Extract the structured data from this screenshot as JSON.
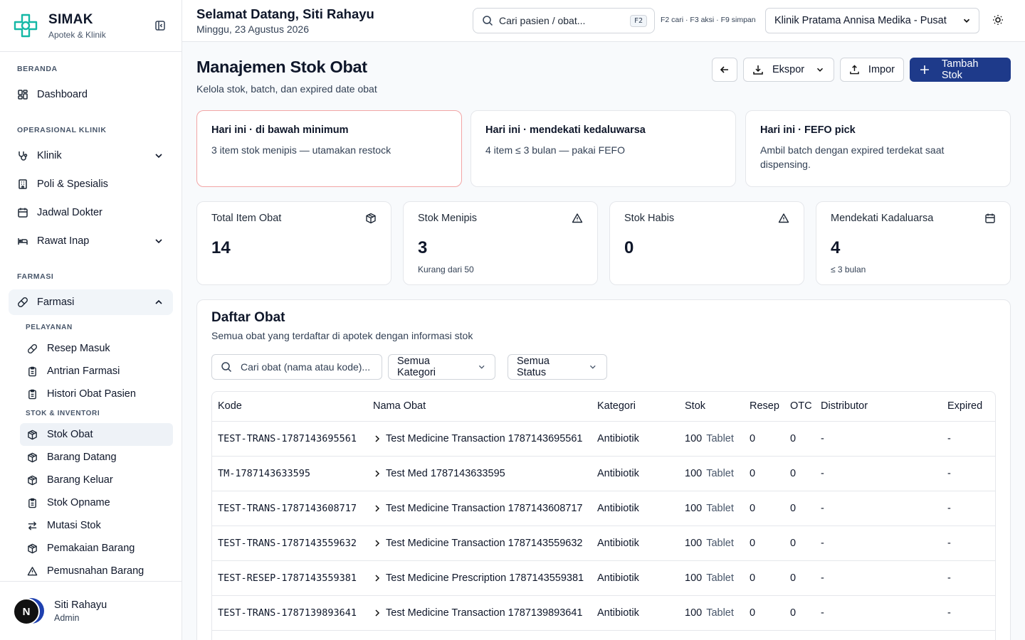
{
  "brand": {
    "name": "SIMAK",
    "subtitle": "Apotek & Klinik"
  },
  "sidebar": {
    "sections": {
      "beranda": "BERANDA",
      "operasional": "OPERASIONAL KLINIK",
      "farmasi": "FARMASI",
      "pelayanan": "PELAYANAN",
      "stok_inventori": "STOK & INVENTORI"
    },
    "items": {
      "dashboard": "Dashboard",
      "klinik": "Klinik",
      "poli": "Poli & Spesialis",
      "jadwal": "Jadwal Dokter",
      "rawat_inap": "Rawat Inap",
      "farmasi": "Farmasi"
    },
    "pelayanan": [
      "Resep Masuk",
      "Antrian Farmasi",
      "Histori Obat Pasien"
    ],
    "stok": [
      "Stok Obat",
      "Barang Datang",
      "Barang Keluar",
      "Stok Opname",
      "Mutasi Stok",
      "Pemakaian Barang",
      "Pemusnahan Barang"
    ]
  },
  "user": {
    "initial": "N",
    "name": "Siti Rahayu",
    "role": "Admin"
  },
  "header": {
    "greeting": "Selamat Datang, Siti Rahayu",
    "date": "Minggu, 23 Agustus 2026",
    "search_placeholder": "Cari pasien / obat...",
    "search_kbd": "F2",
    "hints": "F2 cari · F3 aksi · F9 simpan",
    "clinic": "Klinik Pratama Annisa Medika - Pusat"
  },
  "page": {
    "title": "Manajemen Stok Obat",
    "subtitle": "Kelola stok, batch, dan expired date obat",
    "buttons": {
      "export": "Ekspor",
      "import": "Impor",
      "add": "Tambah Stok"
    }
  },
  "alerts": [
    {
      "title": "Hari ini · di bawah minimum",
      "text": "3 item stok menipis — utamakan restock"
    },
    {
      "title": "Hari ini · mendekati kedaluwarsa",
      "text": "4 item ≤ 3 bulan — pakai FEFO"
    },
    {
      "title": "Hari ini · FEFO pick",
      "text": "Ambil batch dengan expired terdekat saat dispensing."
    }
  ],
  "stats": [
    {
      "label": "Total Item Obat",
      "value": "14",
      "note": "",
      "icon": "package-icon"
    },
    {
      "label": "Stok Menipis",
      "value": "3",
      "note": "Kurang dari 50",
      "icon": "warning-icon"
    },
    {
      "label": "Stok Habis",
      "value": "0",
      "note": "",
      "icon": "warning-icon"
    },
    {
      "label": "Mendekati Kadaluarsa",
      "value": "4",
      "note": "≤ 3 bulan",
      "icon": "calendar-icon"
    }
  ],
  "list": {
    "title": "Daftar Obat",
    "subtitle": "Semua obat yang terdaftar di apotek dengan informasi stok",
    "search_placeholder": "Cari obat (nama atau kode)...",
    "category_filter": "Semua Kategori",
    "status_filter": "Semua Status",
    "columns": [
      "Kode",
      "Nama Obat",
      "Kategori",
      "Stok",
      "Resep",
      "OTC",
      "Distributor",
      "Expired"
    ],
    "rows": [
      {
        "code": "TEST-TRANS-1787143695561",
        "name": "Test Medicine Transaction 1787143695561",
        "category": "Antibiotik",
        "stock": "100",
        "unit": "Tablet",
        "resep": "0",
        "otc": "0",
        "distributor": "-",
        "expired": "-"
      },
      {
        "code": "TM-1787143633595",
        "name": "Test Med 1787143633595",
        "category": "Antibiotik",
        "stock": "100",
        "unit": "Tablet",
        "resep": "0",
        "otc": "0",
        "distributor": "-",
        "expired": "-"
      },
      {
        "code": "TEST-TRANS-1787143608717",
        "name": "Test Medicine Transaction 1787143608717",
        "category": "Antibiotik",
        "stock": "100",
        "unit": "Tablet",
        "resep": "0",
        "otc": "0",
        "distributor": "-",
        "expired": "-"
      },
      {
        "code": "TEST-TRANS-1787143559632",
        "name": "Test Medicine Transaction 1787143559632",
        "category": "Antibiotik",
        "stock": "100",
        "unit": "Tablet",
        "resep": "0",
        "otc": "0",
        "distributor": "-",
        "expired": "-"
      },
      {
        "code": "TEST-RESEP-1787143559381",
        "name": "Test Medicine Prescription 1787143559381",
        "category": "Antibiotik",
        "stock": "100",
        "unit": "Tablet",
        "resep": "0",
        "otc": "0",
        "distributor": "-",
        "expired": "-"
      },
      {
        "code": "TEST-TRANS-1787139893641",
        "name": "Test Medicine Transaction 1787139893641",
        "category": "Antibiotik",
        "stock": "100",
        "unit": "Tablet",
        "resep": "0",
        "otc": "0",
        "distributor": "-",
        "expired": "-"
      }
    ]
  },
  "colors": {
    "accent": "#1e3a8a",
    "brand": "#14b8a6",
    "alert_border": "#f2a5a5"
  }
}
